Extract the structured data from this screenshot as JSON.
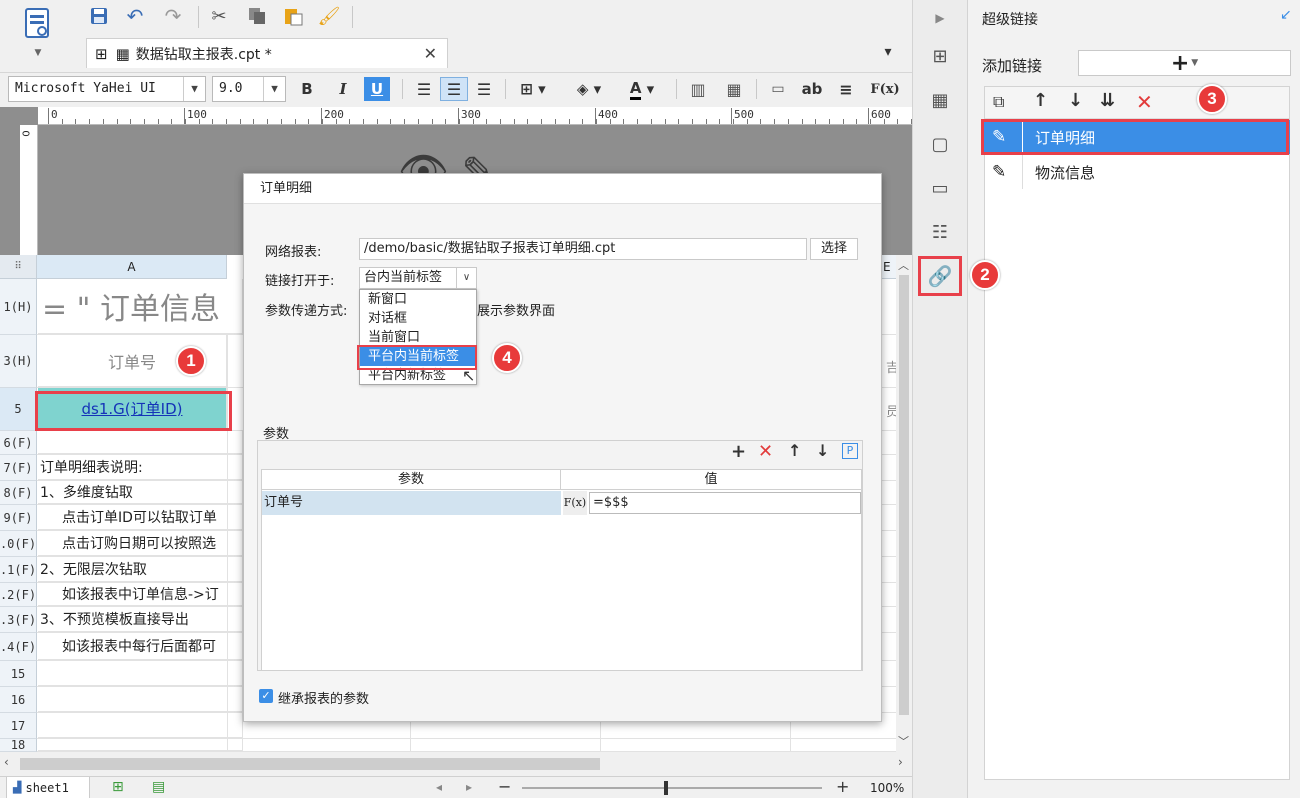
{
  "toolbar": {
    "tab_title": "数据钻取主报表.cpt *",
    "font_name": "Microsoft YaHei UI",
    "font_size": "9.0",
    "bold": "B",
    "italic": "I",
    "underline": "U",
    "ab_label": "ab",
    "formula_label": "F(x)"
  },
  "ruler": {
    "labels": [
      "0",
      "100",
      "200",
      "300",
      "400",
      "500",
      "600"
    ]
  },
  "sheet": {
    "col_a": "A",
    "col_e": "E",
    "rows": [
      {
        "hdr": "1(H)",
        "text": "= \" 订单信息"
      },
      {
        "hdr": "3(H)",
        "text": "订单号"
      },
      {
        "hdr": "5",
        "text": "ds1.G(订单ID)"
      },
      {
        "hdr": "6(F)",
        "text": ""
      },
      {
        "hdr": "7(F)",
        "text": "订单明细表说明:"
      },
      {
        "hdr": "8(F)",
        "text": "1、多维度钻取"
      },
      {
        "hdr": "9(F)",
        "text": "点击订单ID可以钻取订单"
      },
      {
        "hdr": ".0(F)",
        "text": "点击订购日期可以按照选"
      },
      {
        "hdr": ".1(F)",
        "text": "2、无限层次钻取"
      },
      {
        "hdr": ".2(F)",
        "text": "如该报表中订单信息->订"
      },
      {
        "hdr": ".3(F)",
        "text": "3、不预览模板直接导出"
      },
      {
        "hdr": ".4(F)",
        "text": "如该报表中每行后面都可"
      },
      {
        "hdr": "15",
        "text": ""
      },
      {
        "hdr": "16",
        "text": ""
      },
      {
        "hdr": "17",
        "text": ""
      },
      {
        "hdr": "18",
        "text": ""
      }
    ],
    "side_col_chars": [
      "吉",
      "员"
    ]
  },
  "dialog": {
    "title": "订单明细",
    "report_label": "网络报表:",
    "report_path": "/demo/basic/数据钻取子报表订单明细.cpt",
    "select_button": "选择",
    "open_in_label": "链接打开于:",
    "open_in_value": "台内当前标签",
    "param_mode_label": "参数传递方式:",
    "show_param_text": "展示参数界面",
    "dropdown_options": [
      "新窗口",
      "对话框",
      "当前窗口",
      "平台内当前标签",
      "平台内新标签"
    ],
    "selected_option_index": 3,
    "params_section": "参数",
    "param_col": "参数",
    "value_col": "值",
    "param_rows": [
      {
        "name": "订单号",
        "fx": "F(x)",
        "value": "=$$$"
      }
    ],
    "p_button": "P",
    "inherit_label": "继承报表的参数",
    "inherit_checked": true
  },
  "right_panel": {
    "title": "超级链接",
    "add_link_label": "添加链接",
    "add_button": "+",
    "links": [
      "订单明细",
      "物流信息"
    ],
    "selected_index": 0
  },
  "badges": [
    "1",
    "2",
    "3",
    "4"
  ],
  "status_bar": {
    "sheet_name": "sheet1",
    "zoom": "100%"
  },
  "colors": {
    "accent": "#3b8ee6",
    "badge": "#e83a3a",
    "selected_cell": "#7fd3cf"
  }
}
